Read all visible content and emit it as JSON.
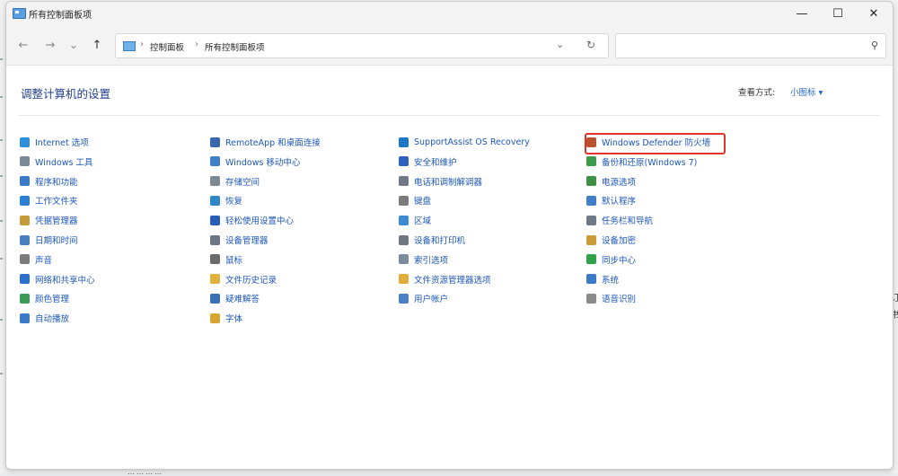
{
  "window": {
    "title": "所有控制面板项",
    "minimize_symbol": "—",
    "maximize_symbol": "☐",
    "close_symbol": "✕"
  },
  "nav": {
    "back_symbol": "←",
    "forward_symbol": "→",
    "recent_symbol": "⌄",
    "up_symbol": "↑",
    "breadcrumb": [
      "控制面板",
      "所有控制面板项"
    ],
    "breadcrumb_separator": "›",
    "dropdown_symbol": "⌄",
    "refresh_symbol": "↻",
    "search_placeholder": "",
    "search_symbol": "⚲"
  },
  "page": {
    "title": "调整计算机的设置",
    "view_by_label": "查看方式:",
    "view_by_value": "小图标 ▾"
  },
  "items": [
    {
      "label": "Internet 选项",
      "icon": "globe-icon",
      "color": "#2f8fd8"
    },
    {
      "label": "Windows 工具",
      "icon": "tools-icon",
      "color": "#7a8a99"
    },
    {
      "label": "程序和功能",
      "icon": "programs-icon",
      "color": "#3a78c8"
    },
    {
      "label": "工作文件夹",
      "icon": "work-folders-icon",
      "color": "#2d7fd3"
    },
    {
      "label": "凭据管理器",
      "icon": "credential-icon",
      "color": "#c59a3a"
    },
    {
      "label": "日期和时间",
      "icon": "clock-icon",
      "color": "#4a7fbf"
    },
    {
      "label": "声音",
      "icon": "speaker-icon",
      "color": "#7c7c7c"
    },
    {
      "label": "网络和共享中心",
      "icon": "network-icon",
      "color": "#2b6fc9"
    },
    {
      "label": "颜色管理",
      "icon": "color-management-icon",
      "color": "#3b9a5a"
    },
    {
      "label": "自动播放",
      "icon": "autoplay-icon",
      "color": "#3a7ac8"
    },
    {
      "label": "RemoteApp 和桌面连接",
      "icon": "remoteapp-icon",
      "color": "#3a66b0"
    },
    {
      "label": "Windows 移动中心",
      "icon": "mobility-icon",
      "color": "#4080c8"
    },
    {
      "label": "存储空间",
      "icon": "storage-icon",
      "color": "#7e8a93"
    },
    {
      "label": "恢复",
      "icon": "recovery-icon",
      "color": "#2f88c8"
    },
    {
      "label": "轻松使用设置中心",
      "icon": "accessibility-icon",
      "color": "#2a5fb8"
    },
    {
      "label": "设备管理器",
      "icon": "device-manager-icon",
      "color": "#6a7684"
    },
    {
      "label": "鼠标",
      "icon": "mouse-icon",
      "color": "#6b6b6b"
    },
    {
      "label": "文件历史记录",
      "icon": "file-history-icon",
      "color": "#e2b13c"
    },
    {
      "label": "疑难解答",
      "icon": "troubleshoot-icon",
      "color": "#3a70b8"
    },
    {
      "label": "字体",
      "icon": "fonts-icon",
      "color": "#d9a531"
    },
    {
      "label": "SupportAssist OS Recovery",
      "icon": "supportassist-icon",
      "color": "#1d77c8"
    },
    {
      "label": "安全和维护",
      "icon": "flag-icon",
      "color": "#2d62c0"
    },
    {
      "label": "电话和调制解调器",
      "icon": "phone-icon",
      "color": "#6f7a86"
    },
    {
      "label": "键盘",
      "icon": "keyboard-icon",
      "color": "#7b7b7b"
    },
    {
      "label": "区域",
      "icon": "region-icon",
      "color": "#3c8ad0"
    },
    {
      "label": "设备和打印机",
      "icon": "printer-icon",
      "color": "#6f7781"
    },
    {
      "label": "索引选项",
      "icon": "indexing-icon",
      "color": "#7c8c9c"
    },
    {
      "label": "文件资源管理器选项",
      "icon": "folder-options-icon",
      "color": "#e1ad3a"
    },
    {
      "label": "用户帐户",
      "icon": "user-accounts-icon",
      "color": "#4a80c6"
    },
    {
      "label": "Windows Defender 防火墙",
      "icon": "firewall-icon",
      "color": "#b8532e"
    },
    {
      "label": "备份和还原(Windows 7)",
      "icon": "backup-icon",
      "color": "#3d9a4a"
    },
    {
      "label": "电源选项",
      "icon": "power-icon",
      "color": "#3f8f45"
    },
    {
      "label": "默认程序",
      "icon": "default-programs-icon",
      "color": "#3f7fc6"
    },
    {
      "label": "任务栏和导航",
      "icon": "taskbar-icon",
      "color": "#6f7a86"
    },
    {
      "label": "设备加密",
      "icon": "key-icon",
      "color": "#c99a35"
    },
    {
      "label": "同步中心",
      "icon": "sync-icon",
      "color": "#2fa24a"
    },
    {
      "label": "系统",
      "icon": "system-icon",
      "color": "#3a7ac8"
    },
    {
      "label": "语音识别",
      "icon": "microphone-icon",
      "color": "#8a8a8a"
    }
  ]
}
